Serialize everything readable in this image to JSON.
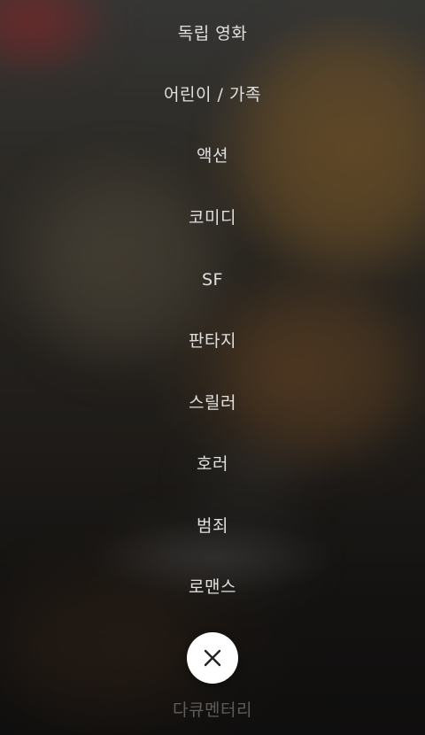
{
  "genres": [
    {
      "label": "독립 영화"
    },
    {
      "label": "어린이 / 가족"
    },
    {
      "label": "액션"
    },
    {
      "label": "코미디"
    },
    {
      "label": "SF"
    },
    {
      "label": "판타지"
    },
    {
      "label": "스릴러"
    },
    {
      "label": "호러"
    },
    {
      "label": "범죄"
    },
    {
      "label": "로맨스"
    },
    {
      "label": "다큐멘터리"
    }
  ],
  "close_button": {
    "icon": "close-icon",
    "color": "#ffffff",
    "icon_color": "#222222"
  }
}
